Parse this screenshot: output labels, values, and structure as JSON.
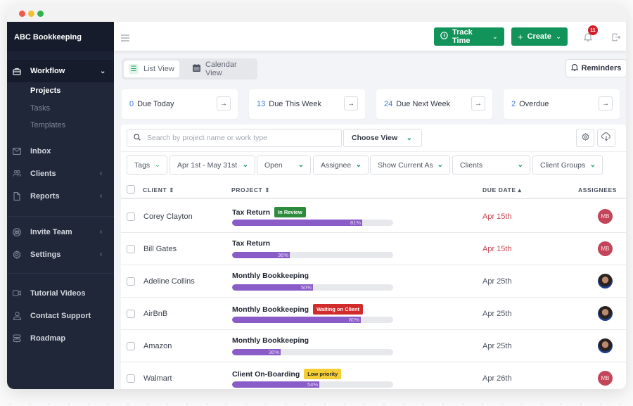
{
  "window": {
    "traffic_lights": [
      "close",
      "minimize",
      "maximize"
    ]
  },
  "sidebar": {
    "brand": "ABC Bookkeeping",
    "workflow": {
      "label": "Workflow",
      "icon": "briefcase-icon",
      "expanded": true,
      "subitems": [
        {
          "label": "Projects",
          "active": true
        },
        {
          "label": "Tasks",
          "active": false
        },
        {
          "label": "Templates",
          "active": false
        }
      ]
    },
    "group1": [
      {
        "label": "Inbox",
        "icon": "mail-icon",
        "has_chevron": false
      },
      {
        "label": "Clients",
        "icon": "users-icon",
        "has_chevron": true
      },
      {
        "label": "Reports",
        "icon": "document-icon",
        "has_chevron": true
      }
    ],
    "group2": [
      {
        "label": "Invite Team",
        "icon": "team-icon",
        "has_chevron": true
      },
      {
        "label": "Settings",
        "icon": "gear-icon",
        "has_chevron": true
      }
    ],
    "group3": [
      {
        "label": "Tutorial Videos",
        "icon": "video-icon"
      },
      {
        "label": "Contact Support",
        "icon": "person-icon"
      },
      {
        "label": "Roadmap",
        "icon": "signpost-icon"
      }
    ]
  },
  "topbar": {
    "track_time": "Track Time",
    "create": "Create",
    "notifications_count": "11"
  },
  "views": {
    "list": "List View",
    "calendar": "Calendar View",
    "active": "list"
  },
  "reminders": "Reminders",
  "due_cards": [
    {
      "count": "0",
      "label": "Due Today"
    },
    {
      "count": "13",
      "label": "Due This Week"
    },
    {
      "count": "24",
      "label": "Due Next Week"
    },
    {
      "count": "2",
      "label": "Overdue"
    }
  ],
  "search": {
    "placeholder": "Search by project name or work type",
    "value": ""
  },
  "choose_view": "Choose View",
  "filters": [
    "Tags",
    "Apr 1st - May 31st",
    "Open",
    "Assignee",
    "Show Current As",
    "Clients",
    "Client Groups"
  ],
  "table": {
    "headers": {
      "client": "CLIENT",
      "project": "PROJECT",
      "due_date": "DUE DATE",
      "assignees": "ASSIGNEES"
    },
    "sort": {
      "column": "due_date",
      "direction": "asc"
    },
    "rows": [
      {
        "client": "Corey Clayton",
        "project": "Tax Return",
        "tag": "In Review",
        "tag_color": "green",
        "progress": 81,
        "progress_label": "81%",
        "due": "Apr 15th",
        "overdue": true,
        "assignee": "MB",
        "assignee_type": "initials"
      },
      {
        "client": "Bill Gates",
        "project": "Tax Return",
        "tag": "",
        "tag_color": "",
        "progress": 36,
        "progress_label": "36%",
        "due": "Apr 15th",
        "overdue": true,
        "assignee": "MB",
        "assignee_type": "initials"
      },
      {
        "client": "Adeline Collins",
        "project": "Monthly Bookkeeping",
        "tag": "",
        "tag_color": "",
        "progress": 50,
        "progress_label": "50%",
        "due": "Apr 25th",
        "overdue": false,
        "assignee": "",
        "assignee_type": "photo"
      },
      {
        "client": "AirBnB",
        "project": "Monthly Bookkeeping",
        "tag": "Waiting on Client",
        "tag_color": "red",
        "progress": 80,
        "progress_label": "80%",
        "due": "Apr 25th",
        "overdue": false,
        "assignee": "",
        "assignee_type": "photo"
      },
      {
        "client": "Amazon",
        "project": "Monthly Bookkeeping",
        "tag": "",
        "tag_color": "",
        "progress": 30,
        "progress_label": "30%",
        "due": "Apr 25th",
        "overdue": false,
        "assignee": "",
        "assignee_type": "photo"
      },
      {
        "client": "Walmart",
        "project": "Client On-Boarding",
        "tag": "Low priority",
        "tag_color": "yellow",
        "progress": 54,
        "progress_label": "54%",
        "due": "Apr 26th",
        "overdue": false,
        "assignee": "MB",
        "assignee_type": "initials"
      }
    ]
  },
  "colors": {
    "brand_green": "#12935a",
    "progress_purple": "#8a5cc7",
    "overdue_red": "#c64450",
    "sidebar_bg": "#1f2739",
    "link_blue": "#3a7bd5"
  }
}
